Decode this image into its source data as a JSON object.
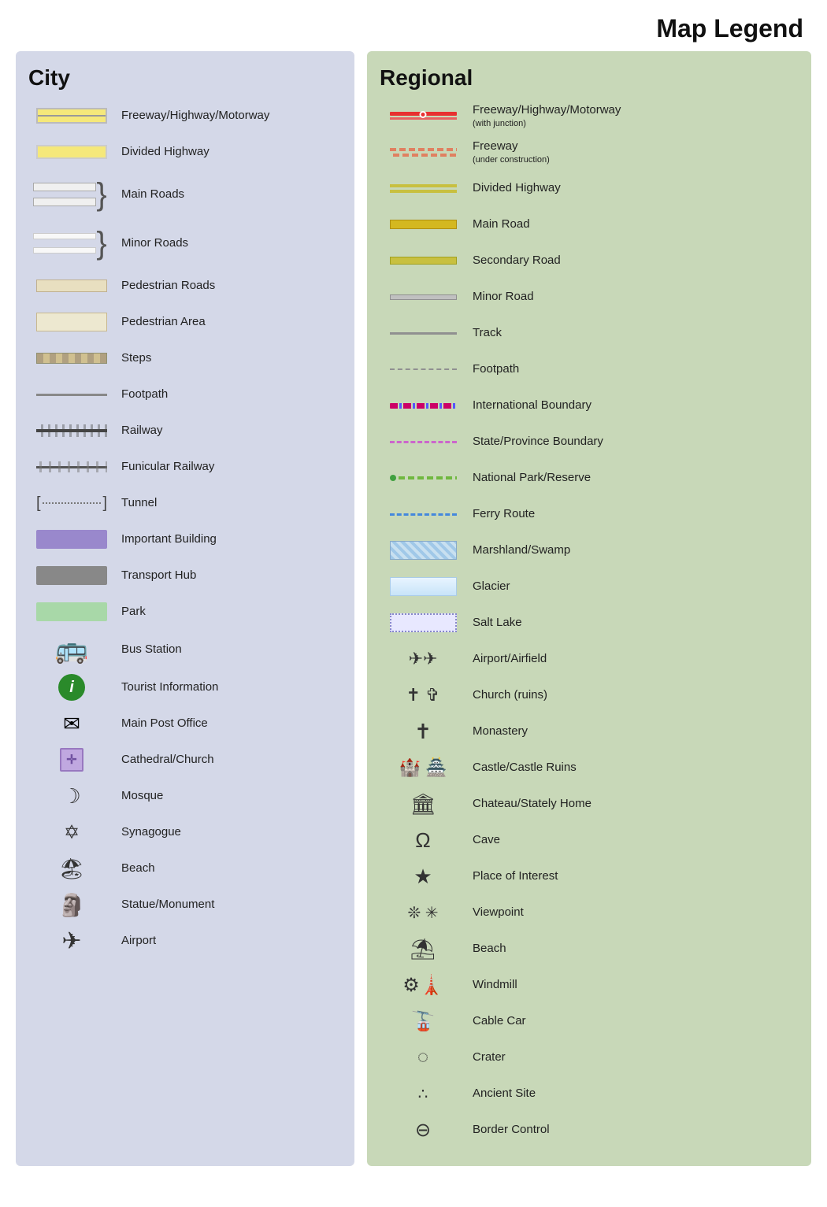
{
  "title": "Map Legend",
  "city": {
    "title": "City",
    "items": [
      {
        "id": "freeway",
        "label": "Freeway/Highway/Motorway",
        "type": "road-freeway-city"
      },
      {
        "id": "divided-highway",
        "label": "Divided Highway",
        "type": "road-divided-city"
      },
      {
        "id": "main-roads",
        "label": "Main Roads",
        "type": "road-main-city"
      },
      {
        "id": "minor-roads",
        "label": "Minor Roads",
        "type": "road-minor-city"
      },
      {
        "id": "pedestrian-roads",
        "label": "Pedestrian Roads",
        "type": "pedestrian"
      },
      {
        "id": "pedestrian-area",
        "label": "Pedestrian Area",
        "type": "pedestrian-area"
      },
      {
        "id": "steps",
        "label": "Steps",
        "type": "steps"
      },
      {
        "id": "footpath",
        "label": "Footpath",
        "type": "footpath"
      },
      {
        "id": "railway",
        "label": "Railway",
        "type": "railway"
      },
      {
        "id": "funicular",
        "label": "Funicular Railway",
        "type": "funicular"
      },
      {
        "id": "tunnel",
        "label": "Tunnel",
        "type": "tunnel"
      },
      {
        "id": "important-building",
        "label": "Important Building",
        "type": "important-building"
      },
      {
        "id": "transport-hub",
        "label": "Transport Hub",
        "type": "transport-hub"
      },
      {
        "id": "park",
        "label": "Park",
        "type": "park"
      },
      {
        "id": "bus-station",
        "label": "Bus Station",
        "type": "bus-icon"
      },
      {
        "id": "tourist-info",
        "label": "Tourist Information",
        "type": "info-icon"
      },
      {
        "id": "post-office",
        "label": "Main Post Office",
        "type": "mail-icon"
      },
      {
        "id": "cathedral",
        "label": "Cathedral/Church",
        "type": "church-icon"
      },
      {
        "id": "mosque",
        "label": "Mosque",
        "type": "mosque-icon"
      },
      {
        "id": "synagogue",
        "label": "Synagogue",
        "type": "synagogue-icon"
      },
      {
        "id": "beach-city",
        "label": "Beach",
        "type": "beach-icon"
      },
      {
        "id": "statue",
        "label": "Statue/Monument",
        "type": "statue-icon"
      },
      {
        "id": "airport-city",
        "label": "Airport",
        "type": "airport-icon"
      }
    ]
  },
  "regional": {
    "title": "Regional",
    "items": [
      {
        "id": "reg-freeway",
        "label": "Freeway/Highway/Motorway",
        "sublabel": "(with junction)",
        "type": "reg-freeway"
      },
      {
        "id": "reg-freeway-construction",
        "label": "Freeway",
        "sublabel": "(under construction)",
        "type": "reg-freeway-construction"
      },
      {
        "id": "reg-divided",
        "label": "Divided Highway",
        "type": "reg-divided"
      },
      {
        "id": "reg-main",
        "label": "Main Road",
        "type": "reg-main-road"
      },
      {
        "id": "reg-secondary",
        "label": "Secondary Road",
        "type": "reg-secondary-road"
      },
      {
        "id": "reg-minor",
        "label": "Minor Road",
        "type": "reg-minor-road"
      },
      {
        "id": "reg-track",
        "label": "Track",
        "type": "reg-track"
      },
      {
        "id": "reg-footpath",
        "label": "Footpath",
        "type": "reg-footpath"
      },
      {
        "id": "reg-intl-boundary",
        "label": "International Boundary",
        "type": "reg-intl-boundary"
      },
      {
        "id": "reg-state-boundary",
        "label": "State/Province Boundary",
        "type": "reg-state-boundary"
      },
      {
        "id": "reg-national-park",
        "label": "National Park/Reserve",
        "type": "reg-national-park"
      },
      {
        "id": "reg-ferry",
        "label": "Ferry Route",
        "type": "reg-ferry"
      },
      {
        "id": "reg-marshland",
        "label": "Marshland/Swamp",
        "type": "reg-marshland"
      },
      {
        "id": "reg-glacier",
        "label": "Glacier",
        "type": "reg-glacier"
      },
      {
        "id": "reg-salt-lake",
        "label": "Salt Lake",
        "type": "reg-salt-lake"
      },
      {
        "id": "reg-airport",
        "label": "Airport/Airfield",
        "type": "reg-airport-icon"
      },
      {
        "id": "reg-church",
        "label": "Church (ruins)",
        "type": "reg-church-icon"
      },
      {
        "id": "reg-monastery",
        "label": "Monastery",
        "type": "reg-monastery-icon"
      },
      {
        "id": "reg-castle",
        "label": "Castle/Castle Ruins",
        "type": "reg-castle-icon"
      },
      {
        "id": "reg-chateau",
        "label": "Chateau/Stately Home",
        "type": "reg-chateau-icon"
      },
      {
        "id": "reg-cave",
        "label": "Cave",
        "type": "reg-cave-icon"
      },
      {
        "id": "reg-poi",
        "label": "Place of Interest",
        "type": "reg-poi-icon"
      },
      {
        "id": "reg-viewpoint",
        "label": "Viewpoint",
        "type": "reg-viewpoint-icon"
      },
      {
        "id": "reg-beach",
        "label": "Beach",
        "type": "reg-beach-icon"
      },
      {
        "id": "reg-windmill",
        "label": "Windmill",
        "type": "reg-windmill-icon"
      },
      {
        "id": "reg-cable-car",
        "label": "Cable Car",
        "type": "reg-cable-car-icon"
      },
      {
        "id": "reg-crater",
        "label": "Crater",
        "type": "reg-crater-icon"
      },
      {
        "id": "reg-ancient",
        "label": "Ancient Site",
        "type": "reg-ancient-icon"
      },
      {
        "id": "reg-border",
        "label": "Border Control",
        "type": "reg-border-icon"
      }
    ]
  }
}
